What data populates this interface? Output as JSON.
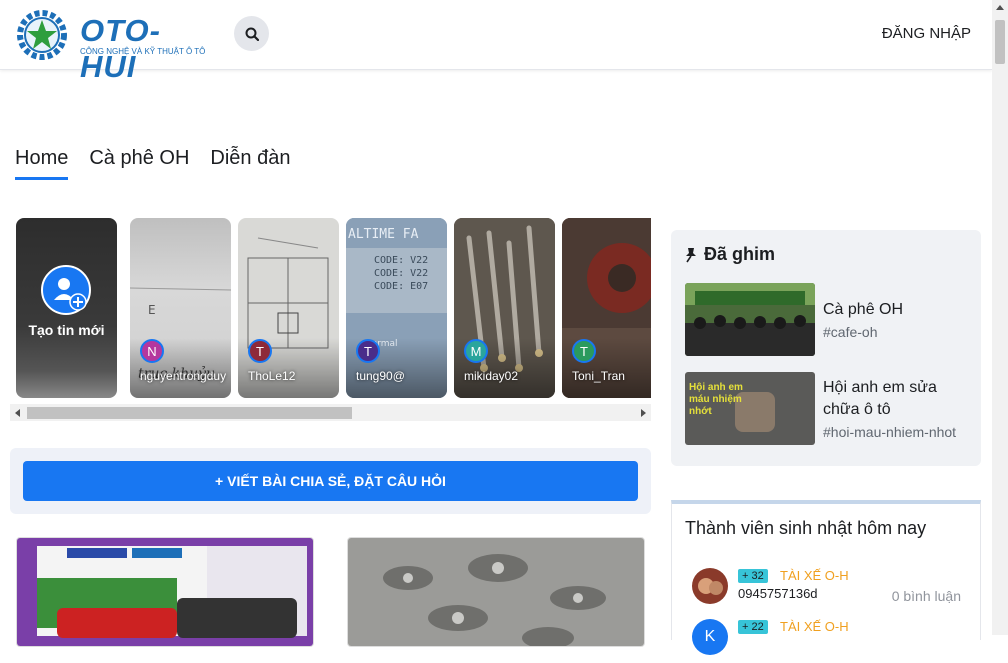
{
  "header": {
    "logo_title": "OTO-HUI",
    "logo_subtitle": "CÔNG NGHỆ VÀ KỸ THUẬT Ô TÔ",
    "search_icon": "search-icon",
    "login_label": "ĐĂNG NHẬP"
  },
  "tabs": [
    {
      "label": "Home",
      "active": true
    },
    {
      "label": "Cà phê OH",
      "active": false
    },
    {
      "label": "Diễn đàn",
      "active": false
    }
  ],
  "stories": {
    "create_label": "Tạo tin mới",
    "items": [
      {
        "initial": "N",
        "name": "nguyentrongduy",
        "color": "#b5379e"
      },
      {
        "initial": "T",
        "name": "ThoLe12",
        "color": "#8e2a3a"
      },
      {
        "initial": "T",
        "name": "tung90@",
        "color": "#4a2d8a"
      },
      {
        "initial": "M",
        "name": "mikiday02",
        "color": "#2aa59c"
      },
      {
        "initial": "T",
        "name": "Toni_Tran",
        "color": "#2b9a5e"
      }
    ]
  },
  "compose": {
    "label": "+ VIẾT BÀI CHIA SẺ, ĐẶT CÂU HỎI"
  },
  "pinned": {
    "title": "Đã ghim",
    "items": [
      {
        "name": "Cà phê OH",
        "tag": "#cafe-oh"
      },
      {
        "name": "Hội anh em sửa chữa ô tô",
        "tag": "#hoi-mau-nhiem-nhot",
        "thumb_text": "Hội anh em máu nhiệm nhớt"
      }
    ]
  },
  "birthday": {
    "title": "Thành viên sinh nhật hôm nay",
    "members": [
      {
        "badge": "+ 32",
        "rank": "TÀI XẾ O-H",
        "name": "0945757136d",
        "comments": "0 bình luận"
      },
      {
        "badge": "+ 22",
        "rank": "TÀI XẾ O-H",
        "initial": "K"
      }
    ]
  },
  "colors": {
    "accent": "#1877f2",
    "rank": "#f0a020",
    "badge": "#37c4d8"
  }
}
